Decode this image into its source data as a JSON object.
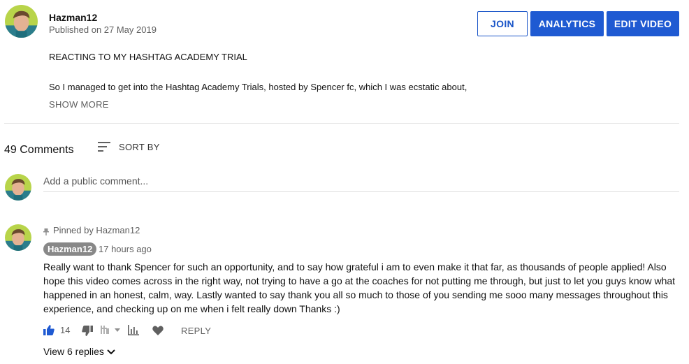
{
  "header": {
    "channel_name": "Hazman12",
    "publish_date": "Published on 27 May 2019",
    "buttons": {
      "join": "JOIN",
      "analytics": "ANALYTICS",
      "edit_video": "EDIT VIDEO"
    }
  },
  "description": {
    "title": "REACTING TO MY HASHTAG ACADEMY TRIAL",
    "body": "So I managed to get into the Hashtag Academy Trials, hosted by Spencer fc, which I was ecstatic about,",
    "show_more": "SHOW MORE"
  },
  "comments_section": {
    "count": "49 Comments",
    "sort_label": "SORT BY",
    "add_placeholder": "Add a public comment...",
    "pinned_comment": {
      "pinned_label": "Pinned by Hazman12",
      "author": "Hazman12",
      "timestamp": "17 hours ago",
      "text": "Really want to thank Spencer for such an opportunity, and to say how grateful i am to even make it that far, as thousands of people applied! Also hope this video comes across in the right way, not trying to have a go at the coaches for not putting me through, but just to let you guys know what happened in an honest, calm, way. Lastly wanted to say thank you all so much to those of you sending me sooo many messages throughout this experience, and checking up on me when i felt really down Thanks :)",
      "like_count": "14",
      "reply_label": "REPLY",
      "view_replies": "View 6 replies"
    }
  },
  "colors": {
    "accent": "#1f5ad2",
    "like_active": "#1f5ad2",
    "icon_gray": "#909090"
  },
  "icons": [
    "avatar",
    "sort-icon",
    "pin-icon",
    "thumbs-up-icon",
    "thumbs-down-icon",
    "dislike-count-icon",
    "analytics-icon",
    "heart-icon",
    "chevron-down-icon"
  ]
}
